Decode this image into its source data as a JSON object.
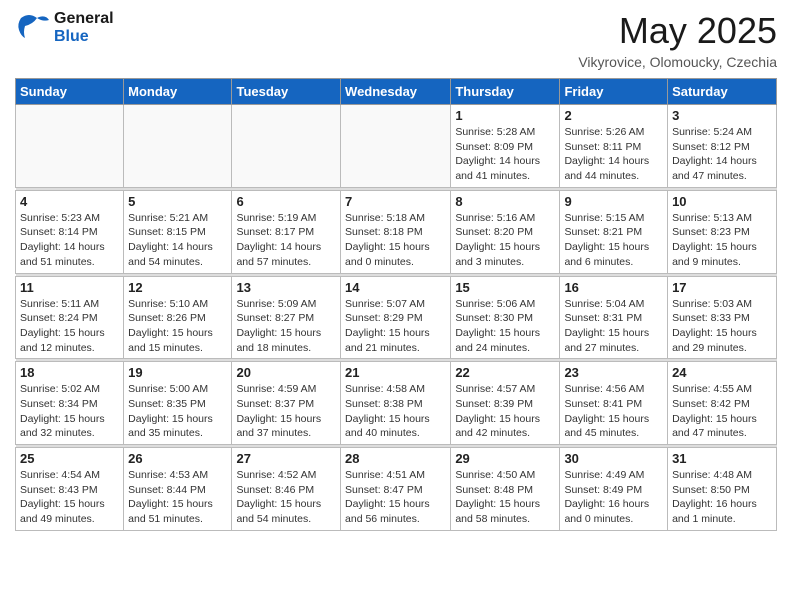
{
  "header": {
    "logo_general": "General",
    "logo_blue": "Blue",
    "month_title": "May 2025",
    "location": "Vikyrovice, Olomoucky, Czechia"
  },
  "weekdays": [
    "Sunday",
    "Monday",
    "Tuesday",
    "Wednesday",
    "Thursday",
    "Friday",
    "Saturday"
  ],
  "weeks": [
    [
      {
        "day": "",
        "info": ""
      },
      {
        "day": "",
        "info": ""
      },
      {
        "day": "",
        "info": ""
      },
      {
        "day": "",
        "info": ""
      },
      {
        "day": "1",
        "info": "Sunrise: 5:28 AM\nSunset: 8:09 PM\nDaylight: 14 hours\nand 41 minutes."
      },
      {
        "day": "2",
        "info": "Sunrise: 5:26 AM\nSunset: 8:11 PM\nDaylight: 14 hours\nand 44 minutes."
      },
      {
        "day": "3",
        "info": "Sunrise: 5:24 AM\nSunset: 8:12 PM\nDaylight: 14 hours\nand 47 minutes."
      }
    ],
    [
      {
        "day": "4",
        "info": "Sunrise: 5:23 AM\nSunset: 8:14 PM\nDaylight: 14 hours\nand 51 minutes."
      },
      {
        "day": "5",
        "info": "Sunrise: 5:21 AM\nSunset: 8:15 PM\nDaylight: 14 hours\nand 54 minutes."
      },
      {
        "day": "6",
        "info": "Sunrise: 5:19 AM\nSunset: 8:17 PM\nDaylight: 14 hours\nand 57 minutes."
      },
      {
        "day": "7",
        "info": "Sunrise: 5:18 AM\nSunset: 8:18 PM\nDaylight: 15 hours\nand 0 minutes."
      },
      {
        "day": "8",
        "info": "Sunrise: 5:16 AM\nSunset: 8:20 PM\nDaylight: 15 hours\nand 3 minutes."
      },
      {
        "day": "9",
        "info": "Sunrise: 5:15 AM\nSunset: 8:21 PM\nDaylight: 15 hours\nand 6 minutes."
      },
      {
        "day": "10",
        "info": "Sunrise: 5:13 AM\nSunset: 8:23 PM\nDaylight: 15 hours\nand 9 minutes."
      }
    ],
    [
      {
        "day": "11",
        "info": "Sunrise: 5:11 AM\nSunset: 8:24 PM\nDaylight: 15 hours\nand 12 minutes."
      },
      {
        "day": "12",
        "info": "Sunrise: 5:10 AM\nSunset: 8:26 PM\nDaylight: 15 hours\nand 15 minutes."
      },
      {
        "day": "13",
        "info": "Sunrise: 5:09 AM\nSunset: 8:27 PM\nDaylight: 15 hours\nand 18 minutes."
      },
      {
        "day": "14",
        "info": "Sunrise: 5:07 AM\nSunset: 8:29 PM\nDaylight: 15 hours\nand 21 minutes."
      },
      {
        "day": "15",
        "info": "Sunrise: 5:06 AM\nSunset: 8:30 PM\nDaylight: 15 hours\nand 24 minutes."
      },
      {
        "day": "16",
        "info": "Sunrise: 5:04 AM\nSunset: 8:31 PM\nDaylight: 15 hours\nand 27 minutes."
      },
      {
        "day": "17",
        "info": "Sunrise: 5:03 AM\nSunset: 8:33 PM\nDaylight: 15 hours\nand 29 minutes."
      }
    ],
    [
      {
        "day": "18",
        "info": "Sunrise: 5:02 AM\nSunset: 8:34 PM\nDaylight: 15 hours\nand 32 minutes."
      },
      {
        "day": "19",
        "info": "Sunrise: 5:00 AM\nSunset: 8:35 PM\nDaylight: 15 hours\nand 35 minutes."
      },
      {
        "day": "20",
        "info": "Sunrise: 4:59 AM\nSunset: 8:37 PM\nDaylight: 15 hours\nand 37 minutes."
      },
      {
        "day": "21",
        "info": "Sunrise: 4:58 AM\nSunset: 8:38 PM\nDaylight: 15 hours\nand 40 minutes."
      },
      {
        "day": "22",
        "info": "Sunrise: 4:57 AM\nSunset: 8:39 PM\nDaylight: 15 hours\nand 42 minutes."
      },
      {
        "day": "23",
        "info": "Sunrise: 4:56 AM\nSunset: 8:41 PM\nDaylight: 15 hours\nand 45 minutes."
      },
      {
        "day": "24",
        "info": "Sunrise: 4:55 AM\nSunset: 8:42 PM\nDaylight: 15 hours\nand 47 minutes."
      }
    ],
    [
      {
        "day": "25",
        "info": "Sunrise: 4:54 AM\nSunset: 8:43 PM\nDaylight: 15 hours\nand 49 minutes."
      },
      {
        "day": "26",
        "info": "Sunrise: 4:53 AM\nSunset: 8:44 PM\nDaylight: 15 hours\nand 51 minutes."
      },
      {
        "day": "27",
        "info": "Sunrise: 4:52 AM\nSunset: 8:46 PM\nDaylight: 15 hours\nand 54 minutes."
      },
      {
        "day": "28",
        "info": "Sunrise: 4:51 AM\nSunset: 8:47 PM\nDaylight: 15 hours\nand 56 minutes."
      },
      {
        "day": "29",
        "info": "Sunrise: 4:50 AM\nSunset: 8:48 PM\nDaylight: 15 hours\nand 58 minutes."
      },
      {
        "day": "30",
        "info": "Sunrise: 4:49 AM\nSunset: 8:49 PM\nDaylight: 16 hours\nand 0 minutes."
      },
      {
        "day": "31",
        "info": "Sunrise: 4:48 AM\nSunset: 8:50 PM\nDaylight: 16 hours\nand 1 minute."
      }
    ]
  ]
}
